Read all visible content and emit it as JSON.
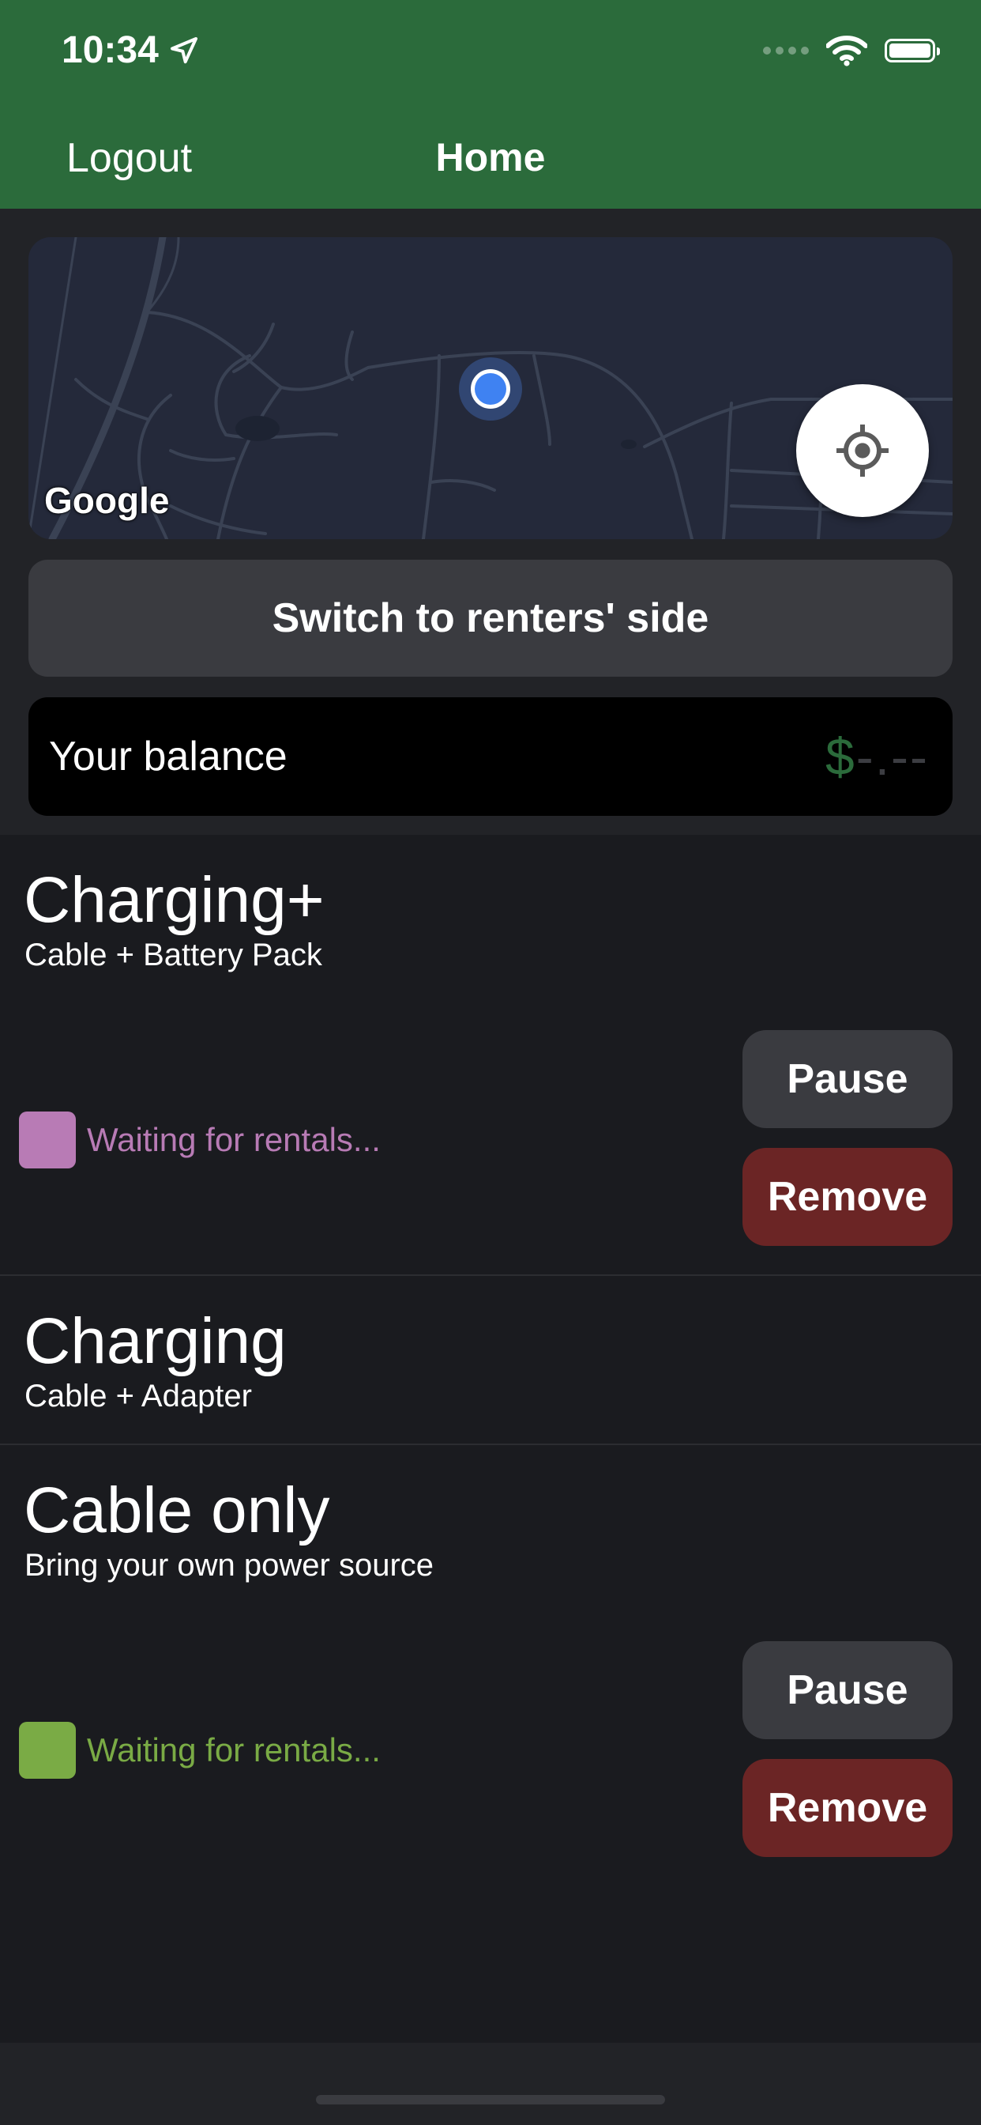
{
  "status_bar": {
    "time": "10:34"
  },
  "nav": {
    "logout_label": "Logout",
    "title": "Home"
  },
  "map": {
    "attribution": "Google"
  },
  "switch_button_label": "Switch to renters' side",
  "balance": {
    "label": "Your balance",
    "currency": "$",
    "value": "-.--"
  },
  "listings": [
    {
      "title": "Charging+",
      "subtitle": "Cable + Battery Pack",
      "status": "Waiting for rentals...",
      "status_color": "#b87bb5",
      "pause_label": "Pause",
      "remove_label": "Remove"
    },
    {
      "title": "Charging",
      "subtitle": "Cable + Adapter"
    },
    {
      "title": "Cable only",
      "subtitle": "Bring your own power source",
      "status": "Waiting for rentals...",
      "status_color": "#7aab45",
      "pause_label": "Pause",
      "remove_label": "Remove"
    }
  ],
  "colors": {
    "nav_green": "#2b6b3b",
    "remove_red": "#6b2525",
    "background": "#1a1b1f"
  }
}
